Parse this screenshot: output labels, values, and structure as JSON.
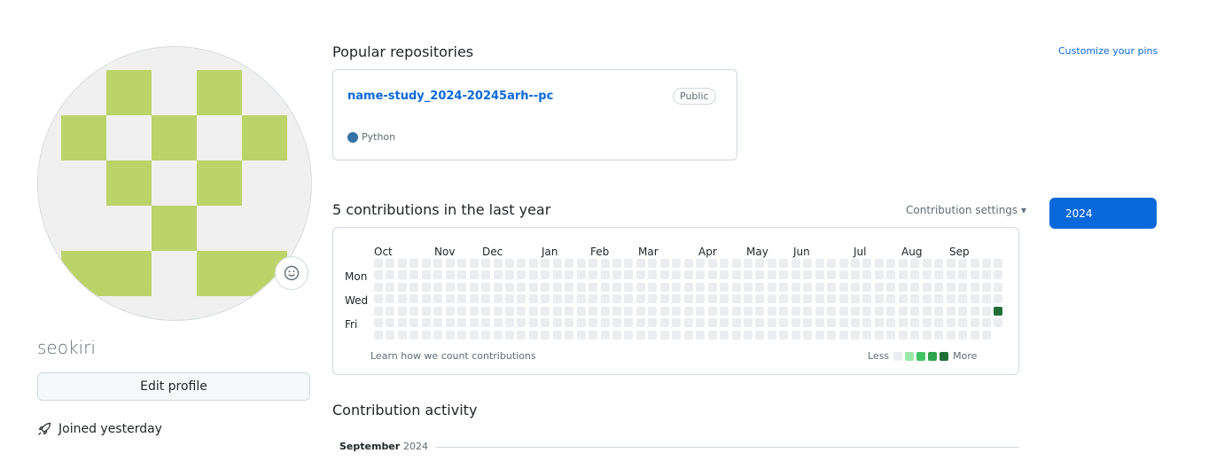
{
  "profile": {
    "username": "seokiri",
    "edit_label": "Edit profile",
    "joined": "Joined yesterday",
    "avatar_color": "#bcd36a"
  },
  "popular": {
    "title": "Popular repositories",
    "customize": "Customize your pins",
    "repo": {
      "name": "name-study_2024-20245arh--pc",
      "visibility": "Public",
      "language": "Python",
      "lang_color": "#3572A5"
    }
  },
  "contrib": {
    "title": "5 contributions in the last year",
    "settings": "Contribution settings ▾",
    "year": "2024",
    "months": [
      "Oct",
      "Nov",
      "Dec",
      "Jan",
      "Feb",
      "Mar",
      "Apr",
      "May",
      "Jun",
      "Jul",
      "Aug",
      "Sep"
    ],
    "days": [
      "Mon",
      "Wed",
      "Fri"
    ],
    "learn": "Learn how we count contributions",
    "less": "Less",
    "more": "More",
    "levels": [
      "#ebedf0",
      "#9be9a8",
      "#40c463",
      "#30a14e",
      "#216e39"
    ]
  },
  "activity": {
    "title": "Contribution activity",
    "month": "September",
    "year": "2024"
  }
}
